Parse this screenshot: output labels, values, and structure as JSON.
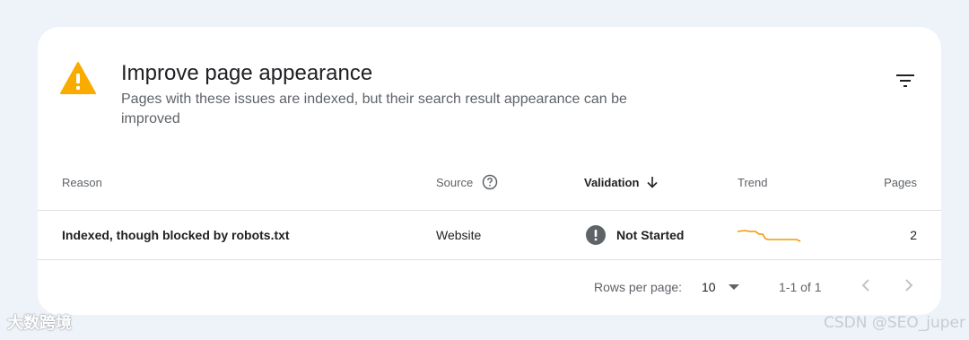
{
  "panel": {
    "title": "Improve page appearance",
    "subtitle": "Pages with these issues are indexed, but their search result appearance can be improved"
  },
  "columns": {
    "reason": "Reason",
    "source": "Source",
    "validation": "Validation",
    "trend": "Trend",
    "pages": "Pages"
  },
  "rows": [
    {
      "reason": "Indexed, though blocked by robots.txt",
      "source": "Website",
      "validation": "Not Started",
      "pages": "2",
      "trend_color": "#f29900"
    }
  ],
  "pagination": {
    "rows_per_page_label": "Rows per page:",
    "rows_per_page_value": "10",
    "range": "1-1 of 1"
  },
  "watermarks": {
    "left": "大数跨境",
    "right": "CSDN @SEO_juper"
  },
  "colors": {
    "warning": "#f9ab00",
    "status_icon": "#5f6368",
    "trend_line": "#f29900",
    "background": "#eef2f9"
  },
  "icons": [
    "warning-icon",
    "filter-icon",
    "help-icon",
    "arrow-down-icon",
    "not-started-icon",
    "chevron-down-icon",
    "chevron-left-icon",
    "chevron-right-icon"
  ]
}
